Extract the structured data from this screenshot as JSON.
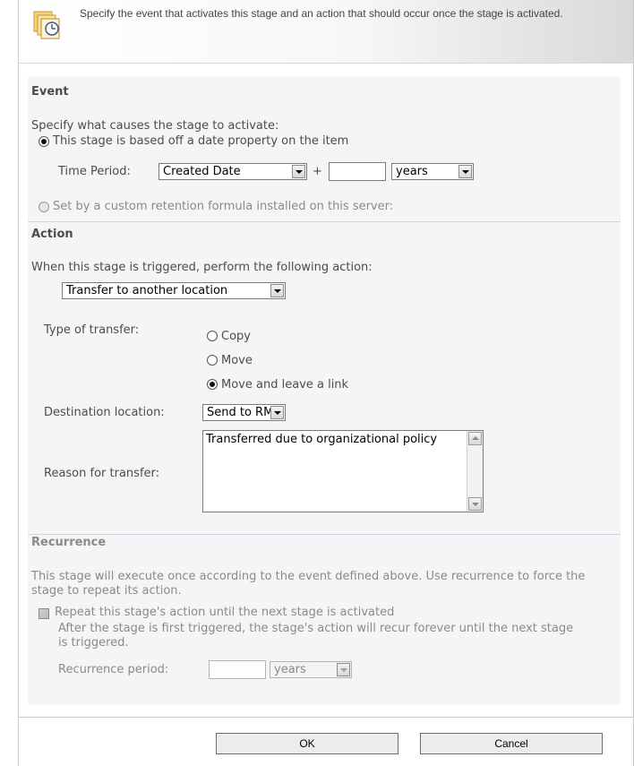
{
  "header": {
    "description": "Specify the event that activates this stage and an action that should occur once the stage is activated.",
    "icon": "calendar-clock-icon"
  },
  "event": {
    "title": "Event",
    "prompt": "Specify what causes the stage to activate:",
    "option_date": "This stage is based off a date property on the item",
    "time_period_label": "Time Period:",
    "date_property": "Created Date",
    "plus": "+",
    "offset_value": "",
    "unit": "years",
    "option_formula": "Set by a custom retention formula installed on this server:"
  },
  "action": {
    "title": "Action",
    "prompt": "When this stage is triggered, perform the following action:",
    "selected_action": "Transfer to another location",
    "type_label": "Type of transfer:",
    "type_options": [
      "Copy",
      "Move",
      "Move and leave a link"
    ],
    "type_selected": "Move and leave a link",
    "destination_label": "Destination location:",
    "destination_value": "Send to RM",
    "reason_label": "Reason for transfer:",
    "reason_value": "Transferred due to organizational policy"
  },
  "recurrence": {
    "title": "Recurrence",
    "description": "This stage will execute once according to the event defined above. Use recurrence to force the stage to repeat its action.",
    "repeat_label": "Repeat this stage's action until the next stage is activated",
    "repeat_note": "After the stage is first triggered, the stage's action will recur forever until the next stage is triggered.",
    "period_label": "Recurrence period:",
    "period_value": "",
    "period_unit": "years"
  },
  "buttons": {
    "ok": "OK",
    "cancel": "Cancel"
  }
}
